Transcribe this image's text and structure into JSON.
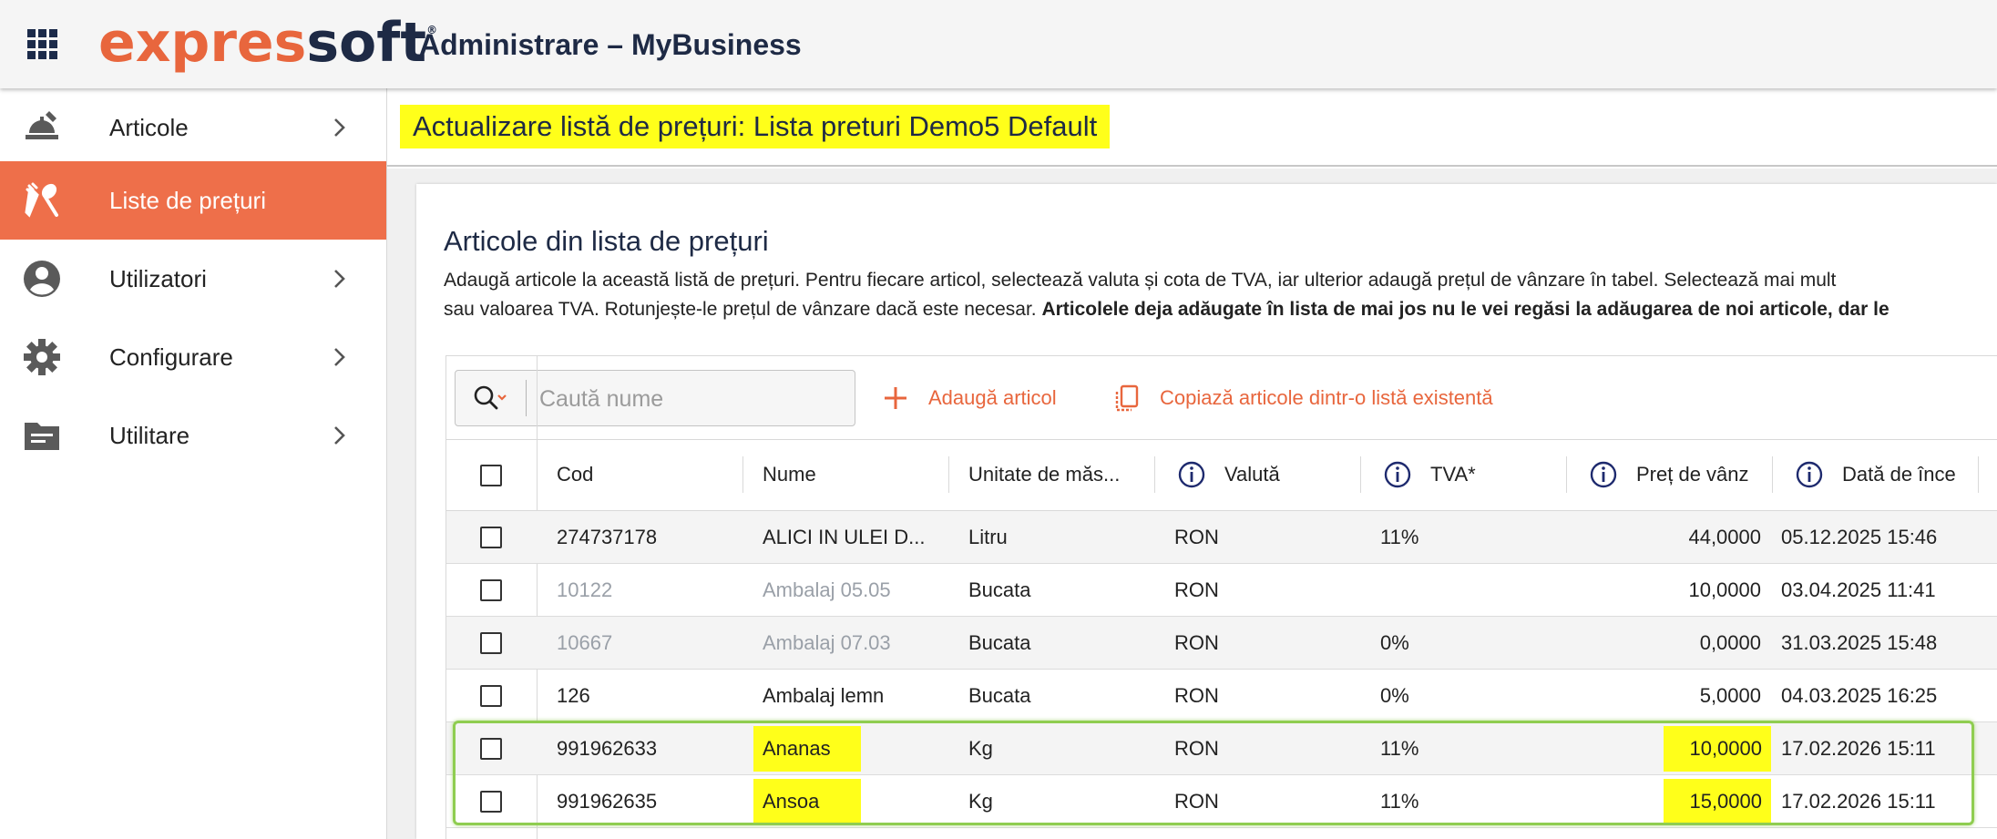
{
  "header": {
    "logo_part1": "expres",
    "logo_part2": "soft",
    "logo_mark": "®",
    "app_title": "Administrare – MyBusiness"
  },
  "sidebar": {
    "items": [
      {
        "label": "Articole",
        "icon": "food-serving-icon",
        "active": false
      },
      {
        "label": "Liste de prețuri",
        "icon": "fork-spoon-icon",
        "active": true
      },
      {
        "label": "Utilizatori",
        "icon": "account-circle-icon",
        "active": false
      },
      {
        "label": "Configurare",
        "icon": "gear-icon",
        "active": false
      },
      {
        "label": "Utilitare",
        "icon": "folder-icon",
        "active": false
      }
    ]
  },
  "page": {
    "title": "Actualizare listă de prețuri: Lista preturi Demo5 Default"
  },
  "section": {
    "title": "Articole din lista de prețuri",
    "desc_line1": "Adaugă articole la această listă de prețuri. Pentru fiecare articol, selectează valuta și cota de TVA, iar ulterior adaugă prețul de vânzare în tabel. Selectează mai mult",
    "desc_line2_plain": "sau valoarea TVA. Rotunjește-le prețul de vânzare dacă este necesar. ",
    "desc_line2_bold": "Articolele deja adăugate în lista de mai jos nu le vei regăsi la adăugarea de noi articole, dar le"
  },
  "toolbar": {
    "search_placeholder": "Caută nume",
    "add_label": "Adaugă articol",
    "copy_label": "Copiază articole dintr-o listă existentă"
  },
  "table": {
    "columns": [
      "Cod",
      "Nume",
      "Unitate de măs...",
      "Valută",
      "TVA*",
      "Preț de vânz",
      "Dată de înce"
    ],
    "rows": [
      {
        "cod": "274737178",
        "nume": "ALICI IN ULEI D...",
        "um": "Litru",
        "valuta": "RON",
        "tva": "11%",
        "pret": "44,0000",
        "data": "05.12.2025 15:46",
        "muted": false
      },
      {
        "cod": "10122",
        "nume": "Ambalaj 05.05",
        "um": "Bucata",
        "valuta": "RON",
        "tva": "",
        "pret": "10,0000",
        "data": "03.04.2025 11:41",
        "muted": true
      },
      {
        "cod": "10667",
        "nume": "Ambalaj 07.03",
        "um": "Bucata",
        "valuta": "RON",
        "tva": "0%",
        "pret": "0,0000",
        "data": "31.03.2025 15:48",
        "muted": true
      },
      {
        "cod": "126",
        "nume": "Ambalaj lemn",
        "um": "Bucata",
        "valuta": "RON",
        "tva": "0%",
        "pret": "5,0000",
        "data": "04.03.2025 16:25",
        "muted": false
      },
      {
        "cod": "991962633",
        "nume": "Ananas",
        "um": "Kg",
        "valuta": "RON",
        "tva": "11%",
        "pret": "10,0000",
        "data": "17.02.2026 15:11",
        "muted": false
      },
      {
        "cod": "991962635",
        "nume": "Ansoa",
        "um": "Kg",
        "valuta": "RON",
        "tva": "11%",
        "pret": "15,0000",
        "data": "17.02.2026 15:11",
        "muted": false
      }
    ]
  },
  "colors": {
    "accent": "#e8663d",
    "navy": "#1e2a45",
    "highlight": "#ffff1a",
    "frame": "#8fcd50"
  }
}
